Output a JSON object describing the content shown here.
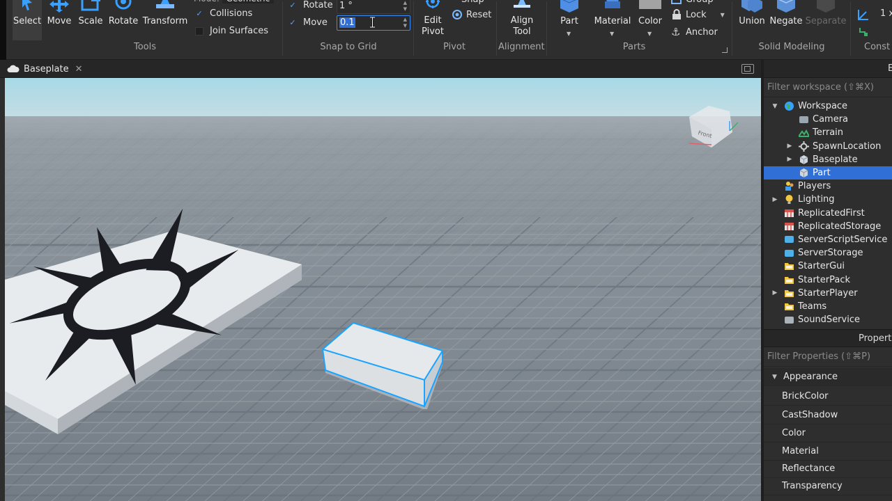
{
  "ribbon": {
    "tools": {
      "buttons": [
        {
          "id": "select",
          "label": "Select"
        },
        {
          "id": "move",
          "label": "Move"
        },
        {
          "id": "scale",
          "label": "Scale"
        },
        {
          "id": "rotate",
          "label": "Rotate"
        },
        {
          "id": "transform",
          "label": "Transform"
        }
      ],
      "collisions_label": "Collisions",
      "collisions_checked": true,
      "join_surfaces_label": "Join Surfaces",
      "join_surfaces_checked": false,
      "group_label": "Tools"
    },
    "snap_to_grid": {
      "rotate_label": "Rotate",
      "rotate_value": "1 °",
      "move_label": "Move",
      "move_value": "0.1",
      "group_label": "Snap to Grid"
    },
    "pivot": {
      "edit_pivot_label": "Edit Pivot",
      "reset_label": "Reset",
      "group_label": "Pivot"
    },
    "alignment": {
      "align_tool_label": "Align Tool",
      "group_label": "Alignment"
    },
    "parts": {
      "part_label": "Part",
      "material_label": "Material",
      "color_label": "Color",
      "lock_label": "Lock",
      "anchor_label": "Anchor",
      "group_label": "Parts"
    },
    "solid_modeling": {
      "union_label": "Union",
      "negate_label": "Negate",
      "separate_label": "Separate",
      "group_label": "Solid Modeling"
    },
    "constraints_group_label": "Const",
    "cut_value": "1 x"
  },
  "tabs": [
    {
      "label": "Baseplate"
    }
  ],
  "explorer": {
    "filter_placeholder": "Filter workspace (⇧⌘X)",
    "items": [
      {
        "label": "Workspace",
        "depth": 0,
        "expanded": true,
        "icon": "workspace-icon"
      },
      {
        "label": "Camera",
        "depth": 1,
        "icon": "camera-icon"
      },
      {
        "label": "Terrain",
        "depth": 1,
        "icon": "terrain-icon"
      },
      {
        "label": "SpawnLocation",
        "depth": 1,
        "collapsed": true,
        "icon": "spawn-icon"
      },
      {
        "label": "Baseplate",
        "depth": 1,
        "collapsed": true,
        "icon": "part-icon"
      },
      {
        "label": "Part",
        "depth": 1,
        "selected": true,
        "icon": "part-icon"
      },
      {
        "label": "Players",
        "depth": 0,
        "icon": "players-icon"
      },
      {
        "label": "Lighting",
        "depth": 0,
        "collapsed": true,
        "icon": "lighting-icon"
      },
      {
        "label": "ReplicatedFirst",
        "depth": 0,
        "icon": "replicated-icon"
      },
      {
        "label": "ReplicatedStorage",
        "depth": 0,
        "icon": "replicated-icon"
      },
      {
        "label": "ServerScriptService",
        "depth": 0,
        "icon": "server-script-icon"
      },
      {
        "label": "ServerStorage",
        "depth": 0,
        "icon": "server-storage-icon"
      },
      {
        "label": "StarterGui",
        "depth": 0,
        "icon": "folder-icon"
      },
      {
        "label": "StarterPack",
        "depth": 0,
        "icon": "folder-icon"
      },
      {
        "label": "StarterPlayer",
        "depth": 0,
        "collapsed": true,
        "icon": "folder-icon"
      },
      {
        "label": "Teams",
        "depth": 0,
        "icon": "folder-icon"
      },
      {
        "label": "SoundService",
        "depth": 0,
        "icon": "sound-icon"
      }
    ]
  },
  "properties": {
    "title": "Properti",
    "filter_placeholder": "Filter Properties (⇧⌘P)",
    "category": "Appearance",
    "rows": [
      "BrickColor",
      "CastShadow",
      "Color",
      "Material",
      "Reflectance",
      "Transparency"
    ]
  },
  "panel_title_cut": "E",
  "viewcube_label": "Front",
  "colors": {
    "accent": "#2f6fd6",
    "selection_outline": "#1aa3ff",
    "ribbon_bg": "#2e2e2e",
    "panel_bg": "#2e2e2e",
    "sky_top": "#9fd0e0",
    "ground": "#7a838c"
  }
}
